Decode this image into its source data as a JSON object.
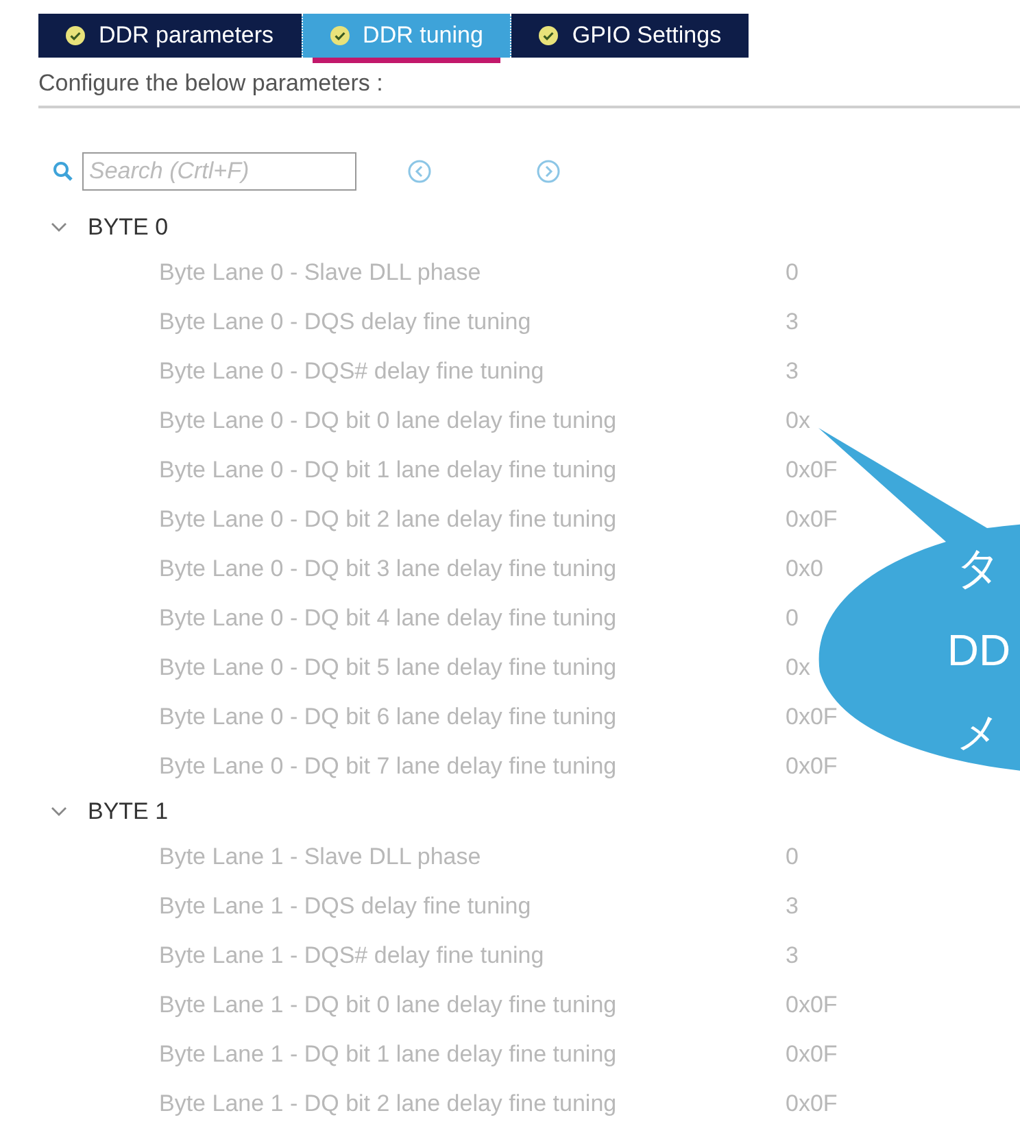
{
  "tabs": [
    {
      "label": "DDR parameters",
      "selected": false
    },
    {
      "label": "DDR tuning",
      "selected": true
    },
    {
      "label": "GPIO Settings",
      "selected": false
    }
  ],
  "instruction": "Configure the below parameters :",
  "search": {
    "placeholder": "Search (Crtl+F)"
  },
  "groups": [
    {
      "title": "BYTE 0",
      "expanded": true,
      "rows": [
        {
          "name": "Byte Lane 0 - Slave DLL phase",
          "value": "0"
        },
        {
          "name": "Byte Lane 0 - DQS delay fine tuning",
          "value": "3"
        },
        {
          "name": "Byte Lane 0 - DQS# delay fine tuning",
          "value": "3"
        },
        {
          "name": "Byte Lane 0 - DQ bit 0 lane delay fine tuning",
          "value": "0x"
        },
        {
          "name": "Byte Lane 0 - DQ bit 1 lane delay fine tuning",
          "value": "0x0F"
        },
        {
          "name": "Byte Lane 0 - DQ bit 2 lane delay fine tuning",
          "value": "0x0F"
        },
        {
          "name": "Byte Lane 0 - DQ bit 3 lane delay fine tuning",
          "value": "0x0"
        },
        {
          "name": "Byte Lane 0 - DQ bit 4 lane delay fine tuning",
          "value": "0"
        },
        {
          "name": "Byte Lane 0 - DQ bit 5 lane delay fine tuning",
          "value": "0x"
        },
        {
          "name": "Byte Lane 0 - DQ bit 6 lane delay fine tuning",
          "value": "0x0F"
        },
        {
          "name": "Byte Lane 0 - DQ bit 7 lane delay fine tuning",
          "value": "0x0F"
        }
      ]
    },
    {
      "title": "BYTE 1",
      "expanded": true,
      "rows": [
        {
          "name": "Byte Lane 1 - Slave DLL phase",
          "value": "0"
        },
        {
          "name": "Byte Lane 1 - DQS delay fine tuning",
          "value": "3"
        },
        {
          "name": "Byte Lane 1 - DQS# delay fine tuning",
          "value": "3"
        },
        {
          "name": "Byte Lane 1 - DQ bit 0 lane delay fine tuning",
          "value": "0x0F"
        },
        {
          "name": "Byte Lane 1 - DQ bit 1 lane delay fine tuning",
          "value": "0x0F"
        },
        {
          "name": "Byte Lane 1 - DQ bit 2 lane delay fine tuning",
          "value": "0x0F"
        }
      ]
    }
  ],
  "callout": {
    "lines": [
      "タ",
      "DD",
      "メ"
    ]
  }
}
